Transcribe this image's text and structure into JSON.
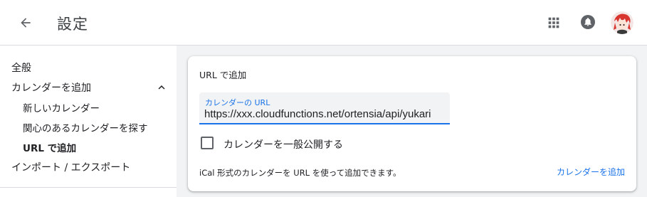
{
  "header": {
    "title": "設定",
    "back_icon": "arrow-back-icon",
    "apps_icon": "apps-grid-icon",
    "notifications_icon": "bell-icon"
  },
  "sidebar": {
    "items": [
      {
        "label": "全般"
      },
      {
        "label": "カレンダーを追加",
        "expanded": true
      },
      {
        "label": "新しいカレンダー"
      },
      {
        "label": "関心のあるカレンダーを探す"
      },
      {
        "label": "URL で追加",
        "selected": true
      },
      {
        "label": "インポート / エクスポート"
      }
    ],
    "chevron_icon": "chevron-up-icon"
  },
  "card": {
    "title": "URL で追加",
    "url_field": {
      "label": "カレンダーの URL",
      "value": "https://xxx.cloudfunctions.net/ortensia/api/yukari"
    },
    "public_checkbox": {
      "label": "カレンダーを一般公開する",
      "checked": false
    },
    "helper_text": "iCal 形式のカレンダーを URL を使って追加できます。",
    "add_button": "カレンダーを追加"
  },
  "colors": {
    "accent": "#1a73e8",
    "background": "#f1f3f4",
    "text": "#202124"
  }
}
